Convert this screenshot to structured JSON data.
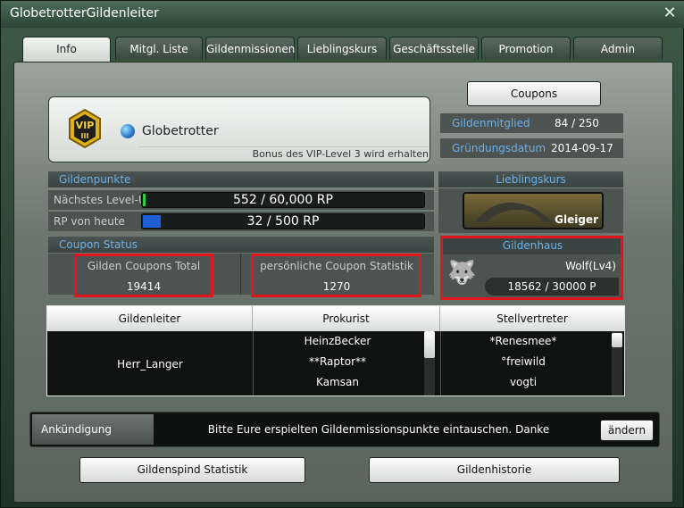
{
  "window": {
    "title": "GlobetrotterGildenleiter"
  },
  "tabs": [
    {
      "label": "Info",
      "active": true
    },
    {
      "label": "Mitgl. Liste",
      "active": false
    },
    {
      "label": "Gildenmissionen",
      "active": false
    },
    {
      "label": "Lieblingskurs",
      "active": false
    },
    {
      "label": "Geschäftsstelle",
      "active": false
    },
    {
      "label": "Promotion",
      "active": false
    },
    {
      "label": "Admin",
      "active": false
    }
  ],
  "guild": {
    "vip_text": "VIP",
    "vip_level": "III",
    "name": "Globetrotter",
    "bonus": "Bonus des VIP-Level 3 wird erhalten"
  },
  "coupons_button": "Coupons",
  "info_rows": [
    {
      "label": "Gildenmitglied",
      "value": "84 / 250"
    },
    {
      "label": "Gründungsdatum",
      "value": "2014-09-17"
    }
  ],
  "gildenpunkte": {
    "header": "Gildenpunkte",
    "level_label": "Nächstes Level-Up",
    "level_value": "552 / 60,000 RP",
    "level_fraction": 0.0092,
    "today_label": "RP von heute",
    "today_value": "32 / 500 RP",
    "today_fraction": 0.064
  },
  "lieblingskurs": {
    "header": "Lieblingskurs",
    "course_name": "Gleiger"
  },
  "coupon_status": {
    "header": "Coupon Status",
    "total_label": "Gilden Coupons Total",
    "total_value": "19414",
    "personal_label": "persönliche Coupon Statistik",
    "personal_value": "1270"
  },
  "gildenhaus": {
    "header": "Gildenhaus",
    "house": "Wolf(Lv4)",
    "points": "18562 / 30000 P"
  },
  "leaders": {
    "headers": [
      "Gildenleiter",
      "Prokurist",
      "Stellvertreter"
    ],
    "gildenleiter": "Herr_Langer",
    "prokurist": [
      "HeinzBecker",
      "**Raptor**",
      "Kamsan"
    ],
    "stellvertreter": [
      "*Renesmee*",
      "°freiwild",
      "vogti"
    ]
  },
  "announcement": {
    "label": "Ankündigung",
    "text": "Bitte Eure erspielten Gildenmissionspunkte eintauschen. Danke",
    "edit_button": "ändern"
  },
  "bottom_buttons": {
    "stats": "Gildenspind Statistik",
    "history": "Gildenhistorie"
  },
  "colors": {
    "accent_blue": "#6fb0e8",
    "highlight_red": "#e4141c",
    "level_bar_fill": "#2ecc40",
    "today_bar_fill": "#1f5fd6"
  }
}
